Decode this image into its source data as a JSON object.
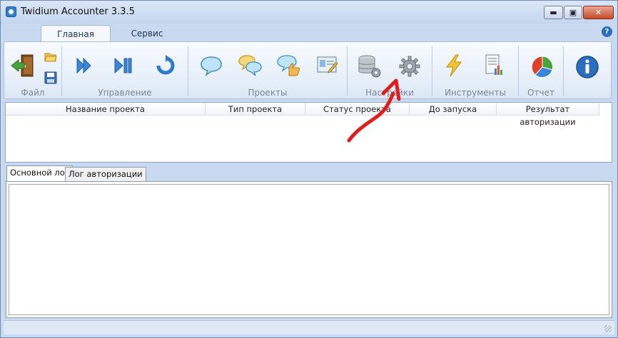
{
  "window": {
    "title": "Twidium Accounter 3.3.5"
  },
  "titlebar": {
    "minimize": "▬",
    "maximize": "▣",
    "close": "✕"
  },
  "ribbon_tabs": [
    {
      "label": "Главная",
      "active": true
    },
    {
      "label": "Сервис",
      "active": false
    }
  ],
  "groups": {
    "file": "Файл",
    "control": "Управление",
    "projects": "Проекты",
    "settings": "Настройки",
    "tools": "Инструменты",
    "report": "Отчет"
  },
  "help_glyph": "?",
  "table": {
    "columns": [
      "Название проекта",
      "Тип проекта",
      "Статус проекта",
      "До запуска",
      "Результат авторизации"
    ]
  },
  "log_tabs": [
    {
      "label": "Основной лог",
      "active": true
    },
    {
      "label": "Лог авторизации",
      "active": false
    }
  ],
  "colors": {
    "annotation_arrow": "#e11d1d",
    "accent": "#2c6dbd"
  }
}
